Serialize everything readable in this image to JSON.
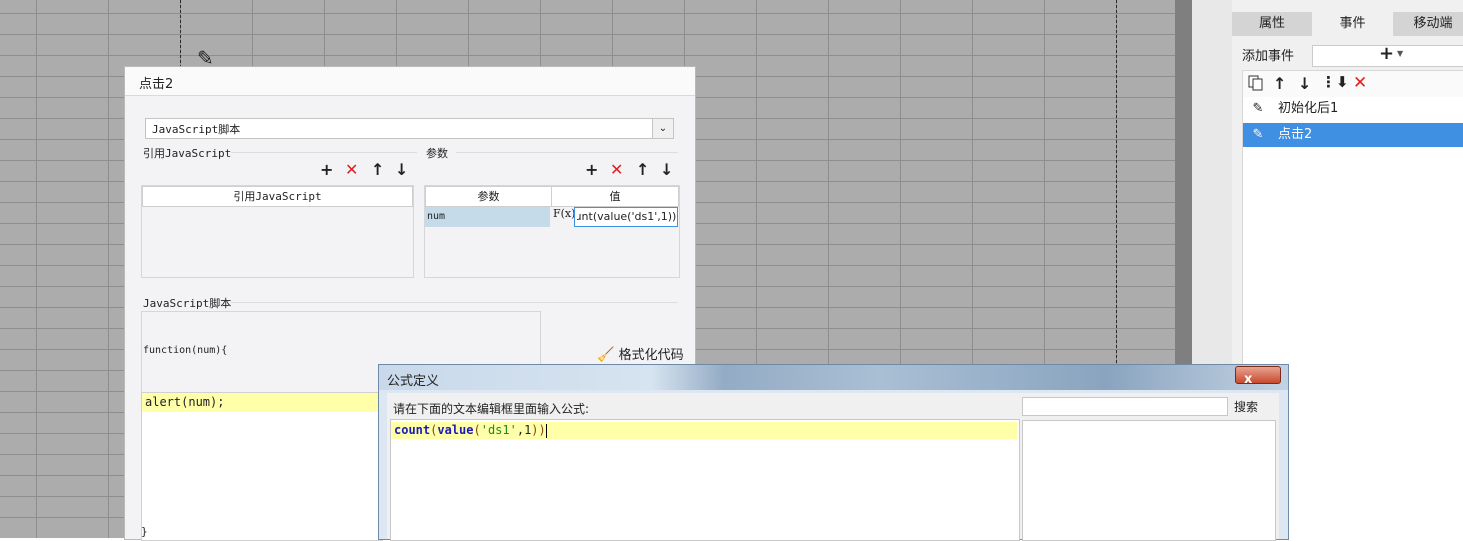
{
  "right_panel": {
    "tabs": [
      "属性",
      "事件",
      "移动端"
    ],
    "active_tab": "事件",
    "add_event_label": "添加事件",
    "add_event_icon": "plus-icon",
    "events": [
      {
        "label": "初始化后1",
        "selected": false
      },
      {
        "label": "点击2",
        "selected": true
      }
    ]
  },
  "event_dialog": {
    "title": "点击2",
    "script_type": "JavaScript脚本",
    "ref_section_label": "引用JavaScript",
    "ref_column": "引用JavaScript",
    "params_section_label": "参数",
    "params_columns": [
      "参数",
      "值"
    ],
    "params_rows": [
      {
        "name": "num",
        "fx_label": "F(x)",
        "value": "ɹnt(value('ds1',1))"
      }
    ],
    "script_section_label": "JavaScript脚本",
    "function_header": "function(num){",
    "format_button": "格式化代码",
    "code_line": "alert(num);",
    "closing_brace": "}"
  },
  "formula_dialog": {
    "title": "公式定义",
    "close_glyph": "x",
    "prompt": "请在下面的文本编辑框里面输入公式:",
    "formula": {
      "fn1": "count",
      "p1": "(",
      "fn2": "value",
      "p2": "(",
      "str": "'ds1'",
      "rest": ",1",
      "p3": "))"
    },
    "search_button": "搜索"
  },
  "colors": {
    "selection_blue": "#3f8fe2",
    "delete_red": "#e02020",
    "highlight_yellow": "#ffffaa",
    "grid_gray": "#acacac"
  }
}
